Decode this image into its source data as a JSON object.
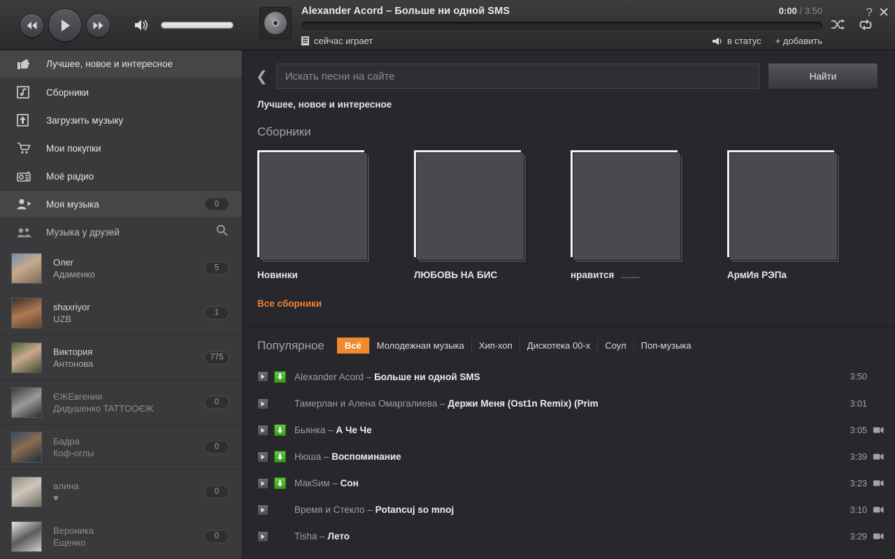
{
  "player": {
    "prev_label": "prev-track",
    "play_label": "play",
    "next_label": "next-track",
    "track_title": "Alexander Acord – Больше ни одной SMS",
    "current_time": "0:00",
    "time_separator": "/",
    "duration": "3:50",
    "now_playing_label": "сейчас играет",
    "status_label": "в статус",
    "add_label": "+ добавить",
    "help_label": "?",
    "close_label": "✕",
    "accent_color": "#f08a2d"
  },
  "sidebar": {
    "nav": [
      {
        "label": "Лучшее, новое и интересное",
        "icon": "thumbs-up-icon",
        "selected": true,
        "badge": null
      },
      {
        "label": "Сборники",
        "icon": "albums-icon",
        "selected": false,
        "badge": null
      },
      {
        "label": "Загрузить музыку",
        "icon": "upload-icon",
        "selected": false,
        "badge": null
      },
      {
        "label": "Мои покупки",
        "icon": "cart-icon",
        "selected": false,
        "badge": null
      },
      {
        "label": "Моё радио",
        "icon": "radio-icon",
        "selected": false,
        "badge": null
      },
      {
        "label": "Моя музыка",
        "icon": "user-play-icon",
        "selected": true,
        "badge": "0"
      },
      {
        "label": "Музыка у друзей",
        "icon": "friends-icon",
        "selected": false,
        "badge": null,
        "search": true
      }
    ],
    "friends": [
      {
        "first": "Олег",
        "second": "Адаменко",
        "count": "5",
        "dim": false
      },
      {
        "first": "shaxriyor",
        "second": "UZB",
        "count": "1",
        "dim": false
      },
      {
        "first": "Виктория",
        "second": "Антонова",
        "count": "775",
        "dim": false
      },
      {
        "first": "ЄЖЕвгении",
        "second": "Дидушенко TATTOOЄЖ",
        "count": "0",
        "dim": true
      },
      {
        "first": "Бадра",
        "second": "Коф-оглы",
        "count": "0",
        "dim": true
      },
      {
        "first": "алина",
        "second": "♥",
        "count": "0",
        "dim": true
      },
      {
        "first": "Вероника",
        "second": "Ещенко",
        "count": "0",
        "dim": true
      }
    ]
  },
  "search": {
    "placeholder": "Искать песни на сайте",
    "value": "",
    "button_label": "Найти"
  },
  "breadcrumb": "Лучшее, новое и интересное",
  "collections": {
    "title": "Сборники",
    "all_link": "Все сборники",
    "albums": [
      {
        "name": "Новинки",
        "suffix": "",
        "badge": "new",
        "art": "vintage-decamerone"
      },
      {
        "name": "ЛЮБОВЬ НА БИС",
        "suffix": "",
        "badge": null,
        "art": "dan-balan-lyubi"
      },
      {
        "name": "нравится",
        "suffix": ".......",
        "badge": null,
        "art": "headphones-girl"
      },
      {
        "name": "АрмИя РЭПа",
        "suffix": "",
        "badge": null,
        "art": "czar-treki-2011"
      }
    ]
  },
  "popular": {
    "title": "Популярное",
    "genres": [
      {
        "label": "Всё",
        "active": true
      },
      {
        "label": "Молодежная музыка",
        "active": false
      },
      {
        "label": "Хип-хоп",
        "active": false
      },
      {
        "label": "Дискотека 00-х",
        "active": false
      },
      {
        "label": "Соул",
        "active": false
      },
      {
        "label": "Поп-музыка",
        "active": false
      }
    ],
    "tracks": [
      {
        "artist": "Alexander Acord – ",
        "name": "Больше ни одной SMS",
        "duration": "3:50",
        "download": true,
        "video": false
      },
      {
        "artist": "Тамерлан и Алена Омаргалиева – ",
        "name": "Держи Меня (Ost1n Remix) (Prim",
        "duration": "3:01",
        "download": false,
        "video": false
      },
      {
        "artist": "Бьянка – ",
        "name": "А Че Че",
        "duration": "3:05",
        "download": true,
        "video": true
      },
      {
        "artist": "Нюша – ",
        "name": "Воспоминание",
        "duration": "3:39",
        "download": true,
        "video": true
      },
      {
        "artist": "МакSим – ",
        "name": "Сон",
        "duration": "3:23",
        "download": true,
        "video": true
      },
      {
        "artist": "Время и Стекло – ",
        "name": "Potancuj so mnoj",
        "duration": "3:10",
        "download": false,
        "video": true
      },
      {
        "artist": "Tisha – ",
        "name": "Лето",
        "duration": "3:29",
        "download": false,
        "video": true
      }
    ]
  }
}
